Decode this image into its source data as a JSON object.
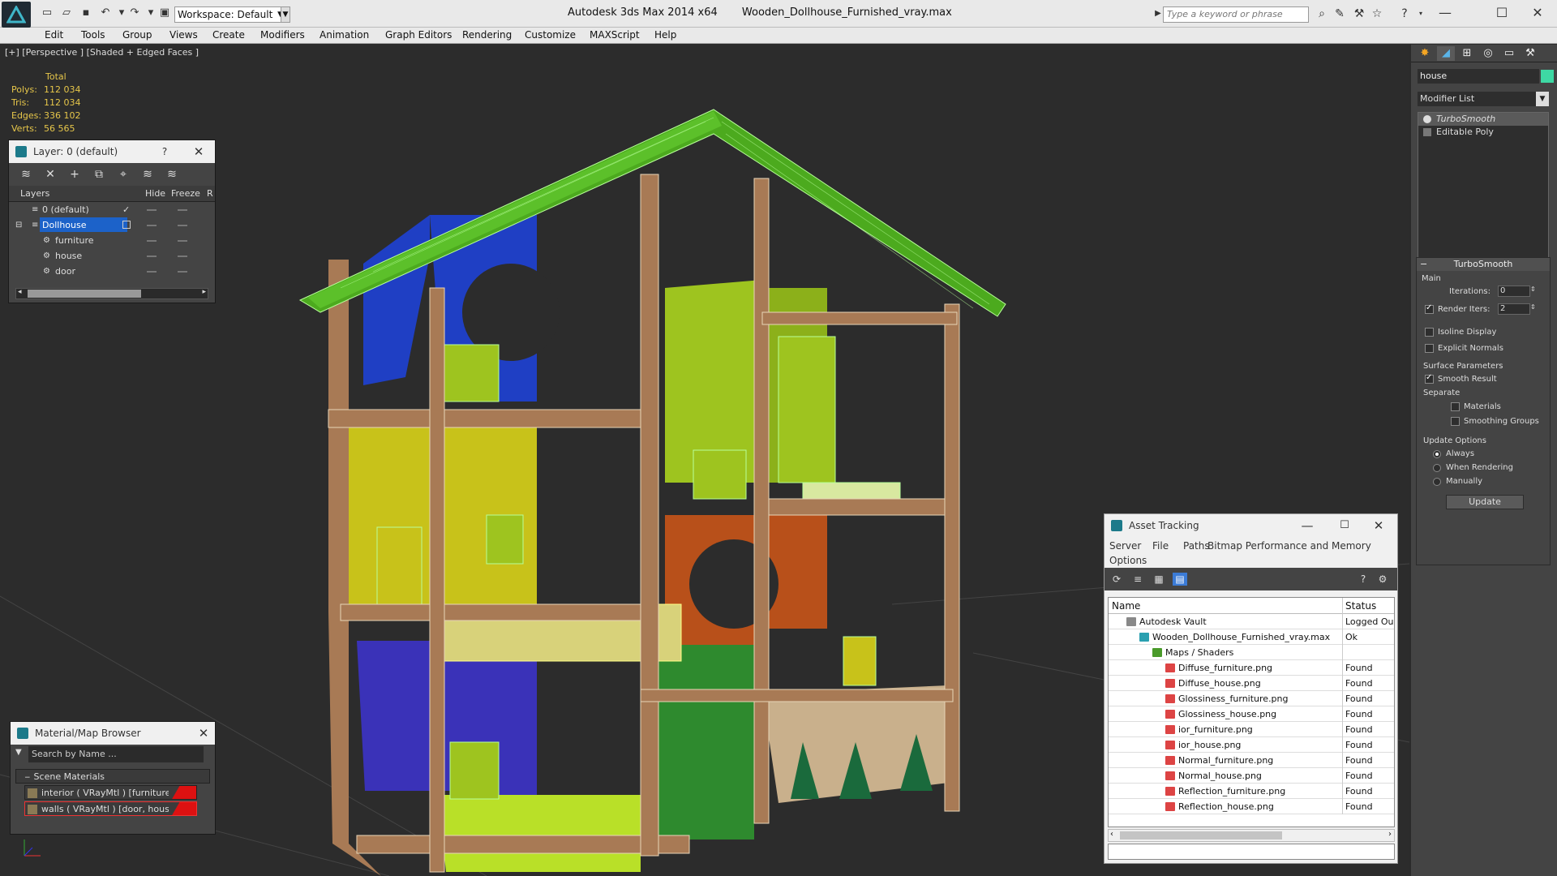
{
  "titlebar": {
    "workspace": "Workspace: Default",
    "app_name": "Autodesk 3ds Max  2014 x64",
    "file_name": "Wooden_Dollhouse_Furnished_vray.max",
    "search_placeholder": "Type a keyword or phrase"
  },
  "menu": [
    "Edit",
    "Tools",
    "Group",
    "Views",
    "Create",
    "Modifiers",
    "Animation",
    "Graph Editors",
    "Rendering",
    "Customize",
    "MAXScript",
    "Help"
  ],
  "viewport": {
    "label": "[+] [Perspective ] [Shaded + Edged Faces ]",
    "stats": {
      "header": "Total",
      "rows": [
        {
          "label": "Polys:",
          "value": "112 034"
        },
        {
          "label": "Tris:",
          "value": "112 034"
        },
        {
          "label": "Edges:",
          "value": "336 102"
        },
        {
          "label": "Verts:",
          "value": "56 565"
        }
      ]
    }
  },
  "layer_panel": {
    "title": "Layer: 0 (default)",
    "help": "?",
    "columns": [
      "Layers",
      "Hide",
      "Freeze",
      "R"
    ],
    "rows": [
      {
        "name": "0 (default)",
        "indent": 0,
        "selected": false,
        "current": true
      },
      {
        "name": "Dollhouse",
        "indent": 0,
        "selected": true,
        "current": false
      },
      {
        "name": "furniture",
        "indent": 1,
        "selected": false,
        "current": false
      },
      {
        "name": "house",
        "indent": 1,
        "selected": false,
        "current": false
      },
      {
        "name": "door",
        "indent": 1,
        "selected": false,
        "current": false
      }
    ]
  },
  "material_browser": {
    "title": "Material/Map Browser",
    "search_placeholder": "Search by Name ...",
    "section": "Scene Materials",
    "items": [
      {
        "label": "interior  ( VRayMtl ) [furniture]",
        "selected": false
      },
      {
        "label": "walls  ( VRayMtl ) [door, house]",
        "selected": true
      }
    ]
  },
  "asset_tracking": {
    "title": "Asset Tracking",
    "menu": [
      "Server",
      "File",
      "Paths",
      "Bitmap Performance and Memory",
      "Options"
    ],
    "columns": [
      "Name",
      "Status"
    ],
    "rows": [
      {
        "name": "Autodesk Vault",
        "status": "Logged Ou",
        "indent": 1,
        "icon": "vault-icon"
      },
      {
        "name": "Wooden_Dollhouse_Furnished_vray.max",
        "status": "Ok",
        "indent": 2,
        "icon": "max-file-icon"
      },
      {
        "name": "Maps / Shaders",
        "status": "",
        "indent": 3,
        "icon": "maps-folder-icon"
      },
      {
        "name": "Diffuse_furniture.png",
        "status": "Found",
        "indent": 4,
        "icon": "png-icon"
      },
      {
        "name": "Diffuse_house.png",
        "status": "Found",
        "indent": 4,
        "icon": "png-icon"
      },
      {
        "name": "Glossiness_furniture.png",
        "status": "Found",
        "indent": 4,
        "icon": "png-icon"
      },
      {
        "name": "Glossiness_house.png",
        "status": "Found",
        "indent": 4,
        "icon": "png-icon"
      },
      {
        "name": "ior_furniture.png",
        "status": "Found",
        "indent": 4,
        "icon": "png-icon"
      },
      {
        "name": "ior_house.png",
        "status": "Found",
        "indent": 4,
        "icon": "png-icon"
      },
      {
        "name": "Normal_furniture.png",
        "status": "Found",
        "indent": 4,
        "icon": "png-icon"
      },
      {
        "name": "Normal_house.png",
        "status": "Found",
        "indent": 4,
        "icon": "png-icon"
      },
      {
        "name": "Reflection_furniture.png",
        "status": "Found",
        "indent": 4,
        "icon": "png-icon"
      },
      {
        "name": "Reflection_house.png",
        "status": "Found",
        "indent": 4,
        "icon": "png-icon"
      }
    ]
  },
  "command_panel": {
    "object_name": "house",
    "object_color": "#3ed8a4",
    "modifier_list": "Modifier List",
    "stack": [
      {
        "label": "TurboSmooth",
        "selected": true
      },
      {
        "label": "Editable Poly",
        "selected": false
      }
    ],
    "turbosmooth": {
      "title": "TurboSmooth",
      "main": "Main",
      "iterations_label": "Iterations:",
      "iterations_value": "0",
      "render_iters_label": "Render Iters:",
      "render_iters_value": "2",
      "render_iters_checked": true,
      "isoline_display": "Isoline Display",
      "explicit_normals": "Explicit Normals",
      "surface_parameters": "Surface Parameters",
      "smooth_result": "Smooth Result",
      "separate": "Separate",
      "materials": "Materials",
      "smoothing_groups": "Smoothing Groups",
      "update_options": "Update Options",
      "always": "Always",
      "when_rendering": "When Rendering",
      "manually": "Manually",
      "update_button": "Update"
    }
  },
  "colors": {
    "roof": "#4caa1e",
    "wood": "#a87a55",
    "wall_blue": "#1f3fc4",
    "wall_yellow": "#c8c21a",
    "wall_lime": "#9ec41f",
    "wall_orange": "#b8501a",
    "door_green": "#2e8a2e",
    "wire": "#b8ff9a",
    "selection": "#1c62c9"
  }
}
